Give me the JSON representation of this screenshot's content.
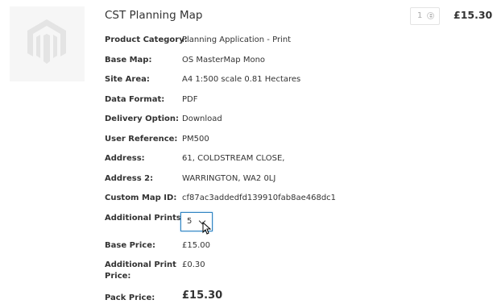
{
  "product": {
    "title": "CST Planning Map",
    "quantity": "1",
    "price": "£15.30",
    "thumbnail_icon": "magento-logo-icon"
  },
  "details": [
    {
      "label": "Product Category:",
      "value": "Planning Application - Print"
    },
    {
      "label": "Base Map:",
      "value": "OS MasterMap Mono"
    },
    {
      "label": "Site Area:",
      "value": "A4 1:500 scale 0.81 Hectares"
    },
    {
      "label": "Data Format:",
      "value": "PDF"
    },
    {
      "label": "Delivery Option:",
      "value": "Download"
    },
    {
      "label": "User Reference:",
      "value": "PM500"
    },
    {
      "label": "Address:",
      "value": "61, COLDSTREAM CLOSE,"
    },
    {
      "label": "Address 2:",
      "value": "WARRINGTON, WA2 0LJ"
    },
    {
      "label": "Custom Map ID:",
      "value": "cf87ac3addedfd139910fab8ae468dc1"
    }
  ],
  "additional_prints": {
    "label": "Additional Prints :",
    "selected": "5"
  },
  "pricing": {
    "base_label": "Base Price:",
    "base_value": "£15.00",
    "additional_label": "Additional Print Price:",
    "additional_value": "£0.30",
    "pack_label": "Pack Price:",
    "pack_value": "£15.30"
  }
}
